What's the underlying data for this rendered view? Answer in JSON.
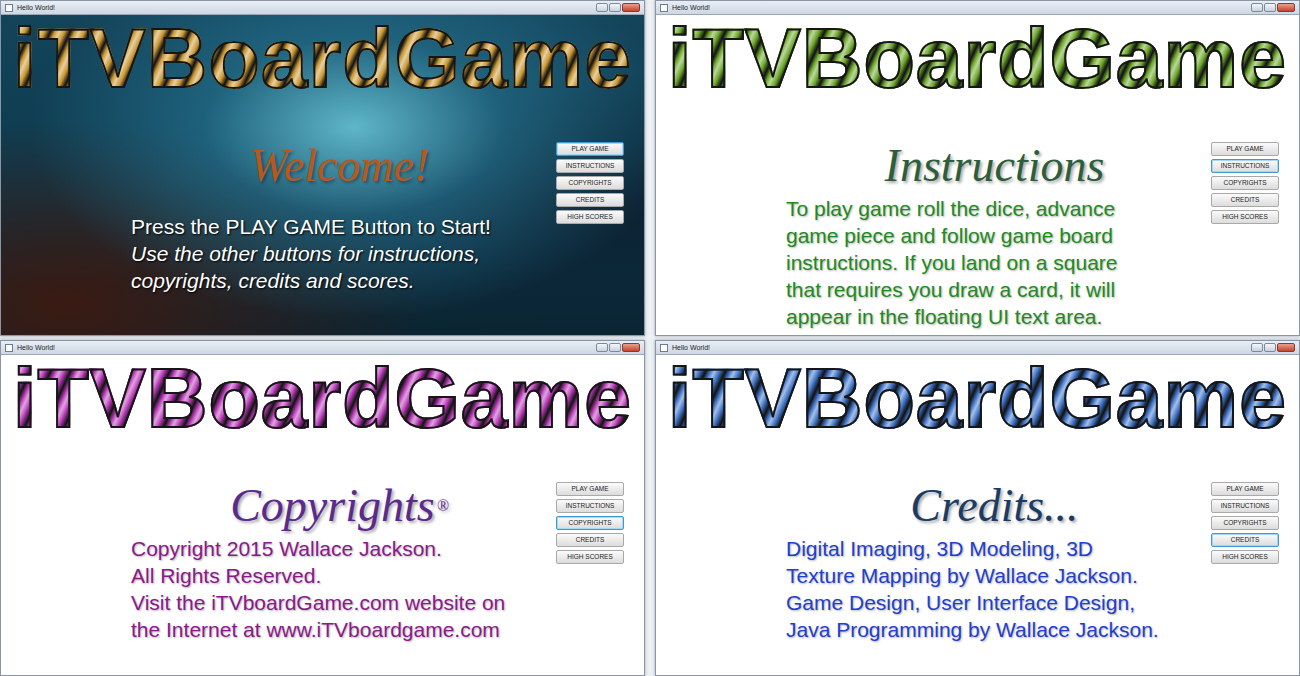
{
  "windows": [
    {
      "title": "Hello World!",
      "kind": "photo",
      "logo": "iTVBoardGame",
      "color": "#c8962a",
      "heading": "Welcome!",
      "heading_color": "#b8581e",
      "text_color": "#ffffff",
      "body": [
        {
          "text": "Press the PLAY GAME Button to Start!",
          "italic": false
        },
        {
          "text": "Use the other buttons for instructions,",
          "italic": true
        },
        {
          "text": "copyrights, credits and scores.",
          "italic": true
        }
      ],
      "buttons": [
        {
          "label": "PLAY GAME",
          "selected": true
        },
        {
          "label": "INSTRUCTIONS",
          "selected": false
        },
        {
          "label": "COPYRIGHTS",
          "selected": false
        },
        {
          "label": "CREDITS",
          "selected": false
        },
        {
          "label": "HIGH SCORES",
          "selected": false
        }
      ]
    },
    {
      "title": "Hello World!",
      "kind": "plain",
      "logo": "iTVBoardGame",
      "color": "#6aa51e",
      "heading": "Instructions",
      "heading_color": "#2c5e3c",
      "text_color": "#1f8a1f",
      "body": [
        {
          "text": "To play game roll the dice, advance",
          "italic": false
        },
        {
          "text": "game piece and follow game board",
          "italic": false
        },
        {
          "text": "instructions. If you land on a square",
          "italic": false
        },
        {
          "text": "that requires you draw a card, it will",
          "italic": false
        },
        {
          "text": "appear in the floating UI text area.",
          "italic": false
        }
      ],
      "buttons": [
        {
          "label": "PLAY GAME",
          "selected": false
        },
        {
          "label": "INSTRUCTIONS",
          "selected": true
        },
        {
          "label": "COPYRIGHTS",
          "selected": false
        },
        {
          "label": "CREDITS",
          "selected": false
        },
        {
          "label": "HIGH SCORES",
          "selected": false
        }
      ]
    },
    {
      "title": "Hello World!",
      "kind": "plain",
      "logo": "iTVBoardGame",
      "color": "#b531b5",
      "heading": "Copyrights",
      "heading_sup": "®",
      "heading_color": "#5a2a8c",
      "text_color": "#8a1a8a",
      "body": [
        {
          "text": "Copyright 2015 Wallace Jackson.",
          "italic": false
        },
        {
          "text": "All Rights Reserved.",
          "italic": false
        },
        {
          "text": "Visit the iTVboardGame.com website on",
          "italic": false
        },
        {
          "text": "the Internet at www.iTVboardgame.com",
          "italic": false
        }
      ],
      "buttons": [
        {
          "label": "PLAY GAME",
          "selected": false
        },
        {
          "label": "INSTRUCTIONS",
          "selected": false
        },
        {
          "label": "COPYRIGHTS",
          "selected": true
        },
        {
          "label": "CREDITS",
          "selected": false
        },
        {
          "label": "HIGH SCORES",
          "selected": false
        }
      ]
    },
    {
      "title": "Hello World!",
      "kind": "plain",
      "logo": "iTVBoardGame",
      "color": "#3a6fc4",
      "heading": "Credits...",
      "heading_color": "#1c3c66",
      "text_color": "#1f3fd0",
      "body": [
        {
          "text": "Digital Imaging, 3D Modeling, 3D",
          "italic": false
        },
        {
          "text": "Texture Mapping by Wallace Jackson.",
          "italic": false
        },
        {
          "text": "Game Design, User Interface Design,",
          "italic": false
        },
        {
          "text": "Java Programming by Wallace Jackson.",
          "italic": false
        }
      ],
      "buttons": [
        {
          "label": "PLAY GAME",
          "selected": false
        },
        {
          "label": "INSTRUCTIONS",
          "selected": false
        },
        {
          "label": "COPYRIGHTS",
          "selected": false
        },
        {
          "label": "CREDITS",
          "selected": true
        },
        {
          "label": "HIGH SCORES",
          "selected": false
        }
      ]
    }
  ]
}
